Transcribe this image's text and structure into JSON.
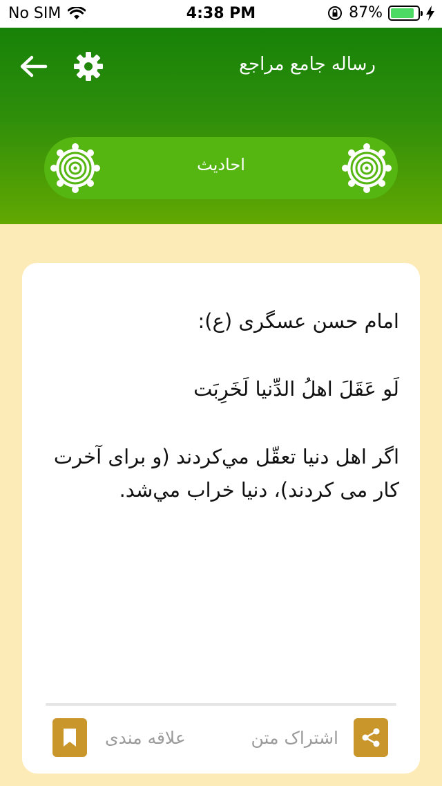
{
  "status_bar": {
    "carrier": "No SIM",
    "time": "4:38 PM",
    "battery": "87%",
    "battery_level": 0.87
  },
  "header": {
    "app_title": "رساله جامع مراجع",
    "section_title": "احادیث"
  },
  "card": {
    "speaker": "امام حسن عسگری (ع):",
    "arabic": "لَو عَقَلَ اهلُ الدِّنیا لَخَرِبَت",
    "translation": "اگر اهل دنیا تعقّل مي‌کردند (و برای آخرت کار می کردند)، دنیا خراب مي‌شد."
  },
  "actions": {
    "share_label": "اشتراک متن",
    "bookmark_label": "علاقه مندی"
  },
  "colors": {
    "header_top": "#178208",
    "header_bottom": "#62a802",
    "pill": "#55b511",
    "page_bg": "#fdebb7",
    "action_icon_bg": "#c8962b"
  }
}
